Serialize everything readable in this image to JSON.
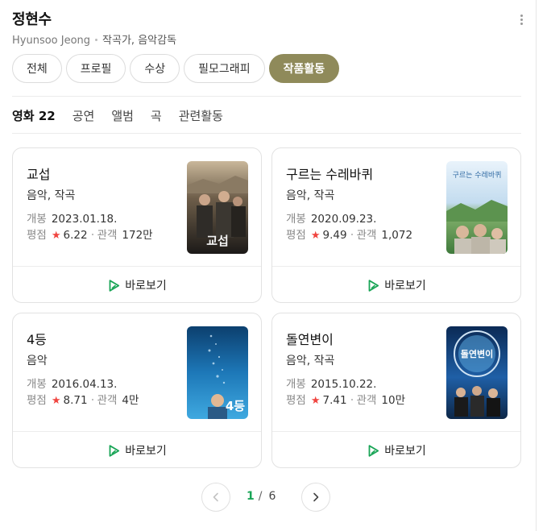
{
  "person": {
    "name": "정현수",
    "english_name": "Hyunsoo Jeong",
    "roles": "작곡가, 음악감독"
  },
  "pills": [
    "전체",
    "프로필",
    "수상",
    "필모그래피",
    "작품활동"
  ],
  "pills_active": "작품활동",
  "tabs": [
    {
      "label": "영화 22",
      "active": true
    },
    {
      "label": "공연",
      "active": false
    },
    {
      "label": "앨범",
      "active": false
    },
    {
      "label": "곡",
      "active": false
    },
    {
      "label": "관련활동",
      "active": false
    }
  ],
  "labels": {
    "release": "개봉",
    "rating": "평점",
    "audience": "관객",
    "star": "★",
    "watch": "바로보기"
  },
  "movies": [
    {
      "title": "교섭",
      "role": "음악, 작곡",
      "release": "2023.01.18.",
      "rating": "6.22",
      "audience": "172만",
      "poster_text": "교섭"
    },
    {
      "title": "구르는 수레바퀴",
      "role": "음악, 작곡",
      "release": "2020.09.23.",
      "rating": "9.49",
      "audience": "1,072",
      "poster_text": "구르는 수레바퀴"
    },
    {
      "title": "4등",
      "role": "음악",
      "release": "2016.04.13.",
      "rating": "8.71",
      "audience": "4만",
      "poster_text": "4등"
    },
    {
      "title": "돌연변이",
      "role": "음악, 작곡",
      "release": "2015.10.22.",
      "rating": "7.41",
      "audience": "10만",
      "poster_text": "돌연변이"
    }
  ],
  "pagination": {
    "current": "1",
    "separator": "/",
    "total": "6"
  },
  "colors": {
    "accent_pill": "#8f8a5a",
    "play_green": "#1aa557",
    "star_red": "#f0443f",
    "page_current": "#1aa557"
  }
}
